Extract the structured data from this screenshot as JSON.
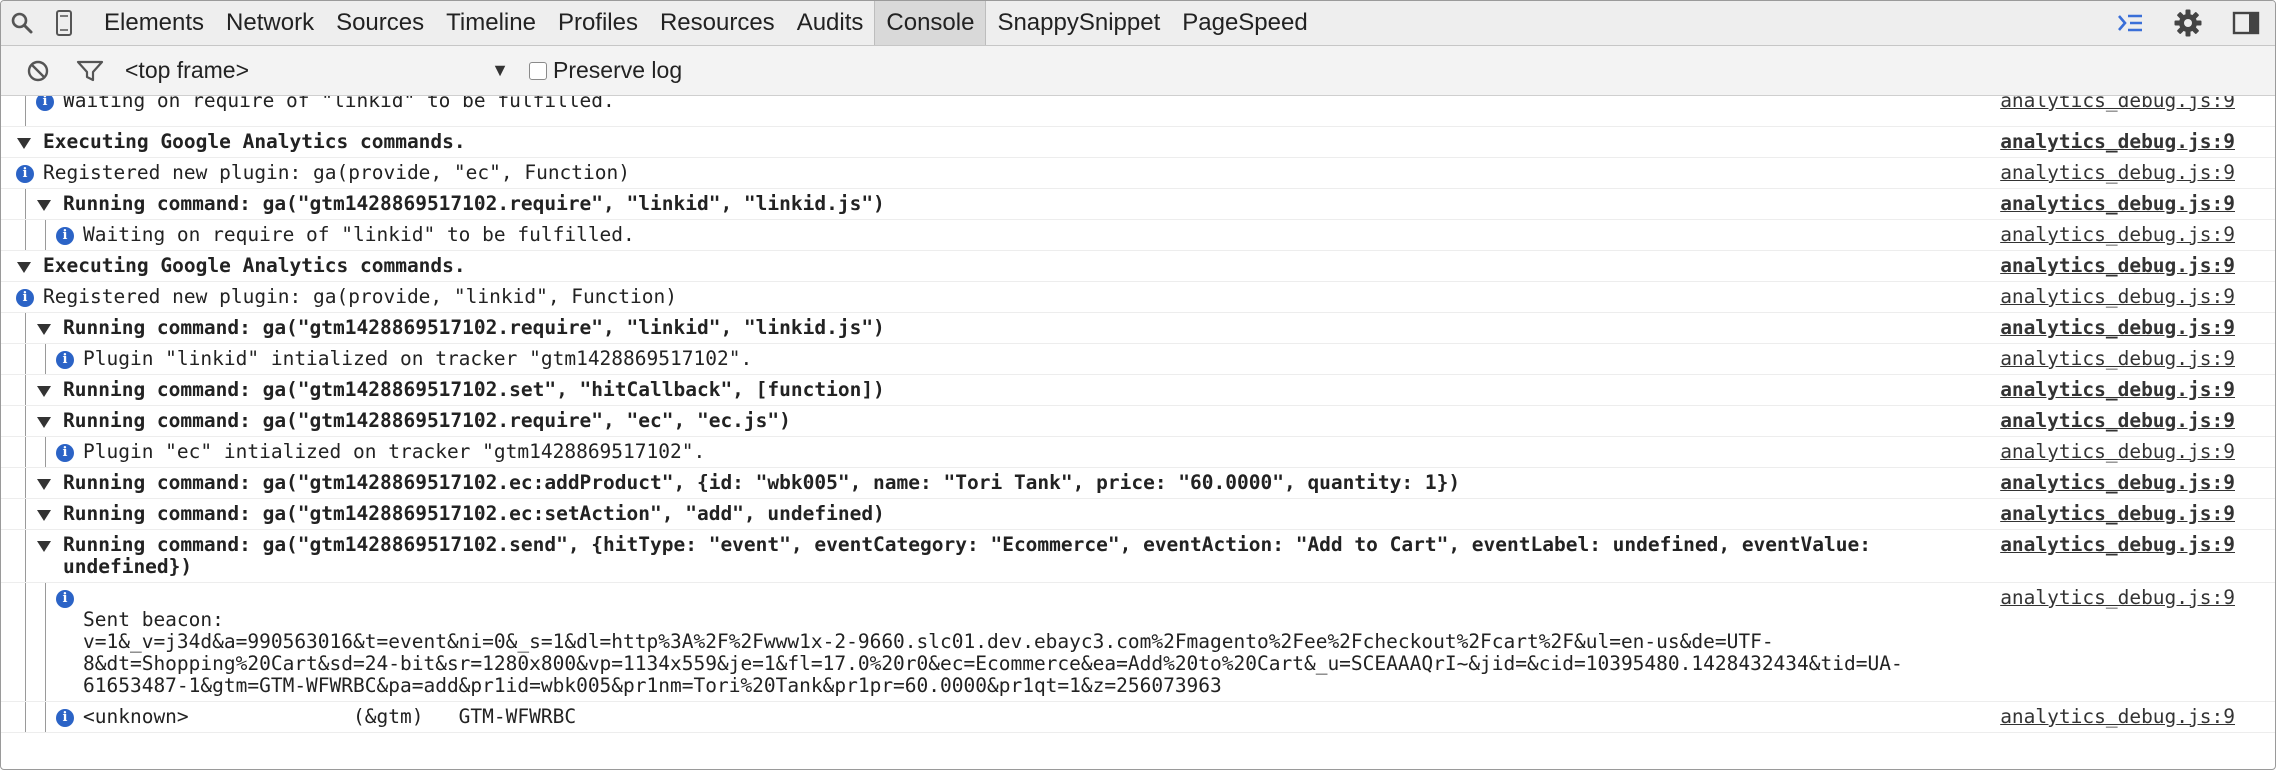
{
  "tabbar": {
    "tabs": [
      "Elements",
      "Network",
      "Sources",
      "Timeline",
      "Profiles",
      "Resources",
      "Audits",
      "Console",
      "SnappySnippet",
      "PageSpeed"
    ],
    "active_tab": "Console",
    "left_icons": [
      "search-icon",
      "device-mode-icon"
    ],
    "right_icons": [
      "show-drawer-icon",
      "gear-icon",
      "dock-side-icon"
    ]
  },
  "toolbar": {
    "clear_icon": "clear-console-icon",
    "filter_icon": "filter-icon",
    "frame_selector": "<top frame>",
    "preserve_log_label": "Preserve log"
  },
  "colors": {
    "info_icon": "#2b63c6",
    "active_tab_bg": "#d9d9d9",
    "toolbar_bg": "#f3f3f3"
  },
  "console": {
    "source_label": "analytics_debug.js:9",
    "messages": [
      {
        "kind": "info",
        "text": "Waiting on require of \"linkid\" to be fulfilled.",
        "bold": false
      },
      {
        "kind": "group",
        "text": "Executing Google Analytics commands.",
        "bold": true
      },
      {
        "kind": "info",
        "text": "Registered new plugin: ga(provide, \"ec\", Function)",
        "bold": false
      },
      {
        "kind": "group",
        "text": "Running command: ga(\"gtm1428869517102.require\", \"linkid\", \"linkid.js\")",
        "bold": true
      },
      {
        "kind": "info",
        "text": "Waiting on require of \"linkid\" to be fulfilled.",
        "bold": false
      },
      {
        "kind": "group",
        "text": "Executing Google Analytics commands.",
        "bold": true
      },
      {
        "kind": "info",
        "text": "Registered new plugin: ga(provide, \"linkid\", Function)",
        "bold": false
      },
      {
        "kind": "group",
        "text": "Running command: ga(\"gtm1428869517102.require\", \"linkid\", \"linkid.js\")",
        "bold": true
      },
      {
        "kind": "info",
        "text": "Plugin \"linkid\" intialized on tracker \"gtm1428869517102\".",
        "bold": false
      },
      {
        "kind": "group",
        "text": "Running command: ga(\"gtm1428869517102.set\", \"hitCallback\", [function])",
        "bold": true
      },
      {
        "kind": "group",
        "text": "Running command: ga(\"gtm1428869517102.require\", \"ec\", \"ec.js\")",
        "bold": true
      },
      {
        "kind": "info",
        "text": "Plugin \"ec\" intialized on tracker \"gtm1428869517102\".",
        "bold": false
      },
      {
        "kind": "group",
        "text": "Running command: ga(\"gtm1428869517102.ec:addProduct\", {id: \"wbk005\", name: \"Tori Tank\", price: \"60.0000\", quantity: 1})",
        "bold": true
      },
      {
        "kind": "group",
        "text": "Running command: ga(\"gtm1428869517102.ec:setAction\", \"add\", undefined)",
        "bold": true
      },
      {
        "kind": "group",
        "text": "Running command: ga(\"gtm1428869517102.send\", {hitType: \"event\", eventCategory: \"Ecommerce\", eventAction: \"Add to Cart\", eventLabel: undefined, eventValue: undefined})",
        "bold": true
      },
      {
        "kind": "info",
        "text": "Sent beacon:\nv=1&_v=j34d&a=990563016&t=event&ni=0&_s=1&dl=http%3A%2F%2Fwww1x-2-9660.slc01.dev.ebayc3.com%2Fmagento%2Fee%2Fcheckout%2Fcart%2F&ul=en-us&de=UTF-\n8&dt=Shopping%20Cart&sd=24-bit&sr=1280x800&vp=1134x559&je=1&fl=17.0%20r0&ec=Ecommerce&ea=Add%20to%20Cart&_u=SCEAAAQrI~&jid=&cid=10395480.1428432434&tid=UA-\n61653487-1&gtm=GTM-WFWRBC&pa=add&pr1id=wbk005&pr1nm=Tori%20Tank&pr1pr=60.0000&pr1qt=1&z=256073963",
        "bold": false
      },
      {
        "kind": "info",
        "text": "<unknown>              (&gtm)   GTM-WFWRBC",
        "bold": false
      }
    ]
  }
}
